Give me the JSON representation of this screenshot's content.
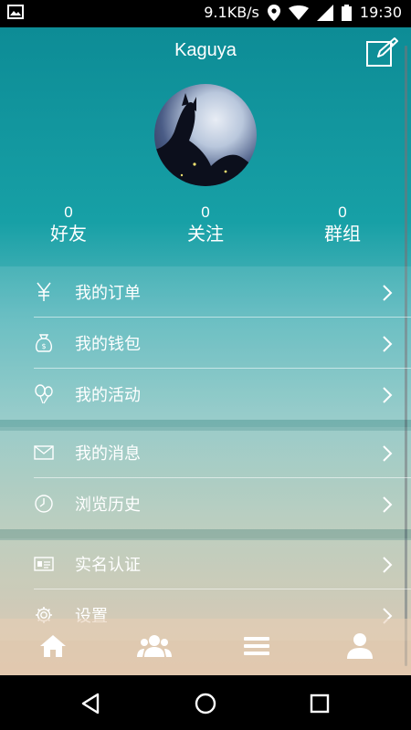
{
  "status_bar": {
    "speed": "9.1KB/s",
    "time": "19:30"
  },
  "header": {
    "title": "Kaguya"
  },
  "stats": [
    {
      "count": "0",
      "label": "好友"
    },
    {
      "count": "0",
      "label": "关注"
    },
    {
      "count": "0",
      "label": "群组"
    }
  ],
  "menu": {
    "group1": [
      {
        "label": "我的订单",
        "icon": "yen-icon"
      },
      {
        "label": "我的钱包",
        "icon": "money-bag-icon"
      },
      {
        "label": "我的活动",
        "icon": "balloons-icon"
      }
    ],
    "group2": [
      {
        "label": "我的消息",
        "icon": "envelope-icon"
      },
      {
        "label": "浏览历史",
        "icon": "clock-icon"
      }
    ],
    "group3": [
      {
        "label": "实名认证",
        "icon": "id-card-icon"
      },
      {
        "label": "设置",
        "icon": "gear-icon"
      }
    ]
  },
  "tabbar": {
    "tabs": [
      "home-icon",
      "people-icon",
      "list-icon",
      "user-icon"
    ],
    "active_index": 3
  },
  "colors": {
    "top_teal": "#0d8c96",
    "bottom_sand": "#dcc2a8"
  }
}
